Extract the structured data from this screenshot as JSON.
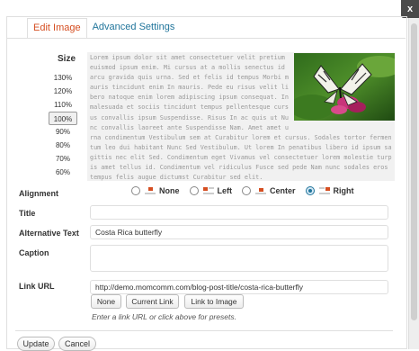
{
  "dialog": {
    "close_label": "x"
  },
  "tabs": [
    {
      "label": "Edit Image"
    },
    {
      "label": "Advanced Settings"
    }
  ],
  "size": {
    "label": "Size",
    "options": [
      "130%",
      "120%",
      "110%",
      "100%",
      "90%",
      "80%",
      "70%",
      "60%"
    ],
    "selected": "100%"
  },
  "preview": {
    "text": "Lorem ipsum dolor sit amet consectetuer velit pretium euismod ipsum enim. Mi cursus at a mollis senectus id arcu gravida quis urna. Sed et felis id tempus Morbi mauris tincidunt enim In mauris. Pede eu risus velit libero natoque enim lorem adipiscing ipsum consequat. In malesuada et sociis tincidunt tempus pellentesque cursus convallis ipsum Suspendisse. Risus In ac quis ut Nunc convallis laoreet ante Suspendisse Nam. Amet amet urna condimentum Vestibulum sem at Curabitur lorem et cursus. Sodales tortor fermentum leo dui habitant Nunc Sed Vestibulum. Ut lorem In penatibus libero id ipsum sagittis nec elit Sed. Condimentum eget Vivamus vel consectetuer lorem molestie turpis amet tellus id. Condimentum vel ridiculus Fusce sed pede Nam nunc sodales eros tempus felis augue dictumst Curabitur sed elit."
  },
  "alignment": {
    "label": "Alignment",
    "options": [
      "None",
      "Left",
      "Center",
      "Right"
    ],
    "selected": "Right"
  },
  "title": {
    "label": "Title",
    "value": ""
  },
  "alt_text": {
    "label": "Alternative Text",
    "value": "Costa Rica butterfly"
  },
  "caption": {
    "label": "Caption",
    "value": ""
  },
  "link": {
    "label": "Link URL",
    "value": "http://demo.momcomm.com/blog-post-title/costa-rica-butterfly",
    "buttons": [
      "None",
      "Current Link",
      "Link to Image"
    ],
    "hint": "Enter a link URL or click above for presets."
  },
  "footer": {
    "update_label": "Update",
    "cancel_label": "Cancel"
  },
  "colors": {
    "accent": "#d54e21",
    "link": "#21759b"
  }
}
